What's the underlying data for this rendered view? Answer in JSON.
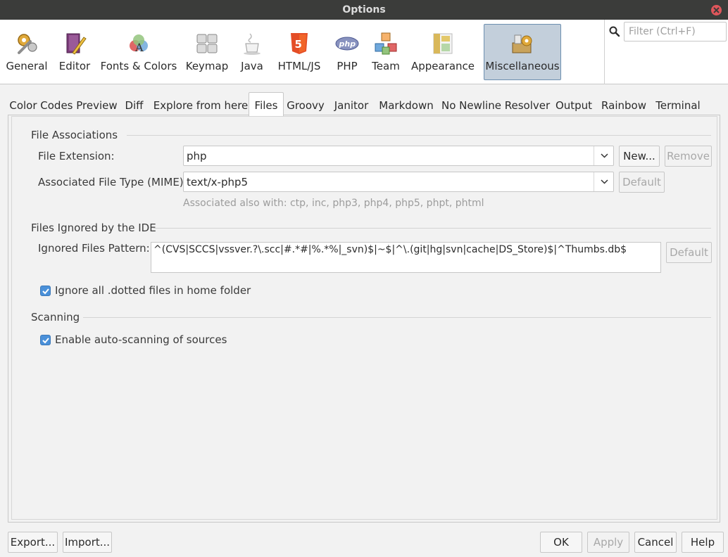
{
  "window": {
    "title": "Options"
  },
  "categories": [
    {
      "label": "General",
      "icon": "general-gears-icon"
    },
    {
      "label": "Editor",
      "icon": "editor-book-pen-icon"
    },
    {
      "label": "Fonts & Colors",
      "icon": "fonts-colors-palette-icon"
    },
    {
      "label": "Keymap",
      "icon": "keymap-keyboard-icon"
    },
    {
      "label": "Java",
      "icon": "java-cup-icon"
    },
    {
      "label": "HTML/JS",
      "icon": "html5-icon"
    },
    {
      "label": "PHP",
      "icon": "php-icon"
    },
    {
      "label": "Team",
      "icon": "team-cubes-icon"
    },
    {
      "label": "Appearance",
      "icon": "appearance-icon"
    },
    {
      "label": "Miscellaneous",
      "icon": "miscellaneous-icon",
      "active": true
    }
  ],
  "search": {
    "placeholder": "Filter (Ctrl+F)"
  },
  "tabs": [
    {
      "label": "Color Codes Preview"
    },
    {
      "label": "Diff"
    },
    {
      "label": "Explore from here"
    },
    {
      "label": "Files",
      "active": true
    },
    {
      "label": "Groovy"
    },
    {
      "label": "Janitor"
    },
    {
      "label": "Markdown"
    },
    {
      "label": "No Newline Resolver"
    },
    {
      "label": "Output"
    },
    {
      "label": "Rainbow"
    },
    {
      "label": "Terminal"
    }
  ],
  "file_associations": {
    "section_title": "File Associations",
    "extension_label": "File Extension:",
    "extension_value": "php",
    "new_button": "New...",
    "remove_button": "Remove",
    "mime_label": "Associated File Type (MIME):",
    "mime_value": "text/x-php5",
    "default_button": "Default",
    "also_with": "Associated also with:  ctp, inc, php3, php4, php5, phpt, phtml"
  },
  "ignored": {
    "section_title": "Files Ignored by the IDE",
    "pattern_label": "Ignored Files Pattern:",
    "pattern_value": "^(CVS|SCCS|vssver.?\\.scc|#.*#|%.*%|_svn)$|~$|^\\.(git|hg|svn|cache|DS_Store)$|^Thumbs.db$",
    "default_button": "Default",
    "dotted_label": "Ignore all .dotted files in home folder",
    "dotted_checked": true
  },
  "scanning": {
    "section_title": "Scanning",
    "auto_label": "Enable auto-scanning of sources",
    "auto_checked": true
  },
  "footer": {
    "export": "Export...",
    "import": "Import...",
    "ok": "OK",
    "apply": "Apply",
    "cancel": "Cancel",
    "help": "Help"
  },
  "colors": {
    "accent": "#4a90d9",
    "active_category_bg": "#c3cfdb",
    "titlebar": "#3b3c3a",
    "close": "#e0565b"
  }
}
